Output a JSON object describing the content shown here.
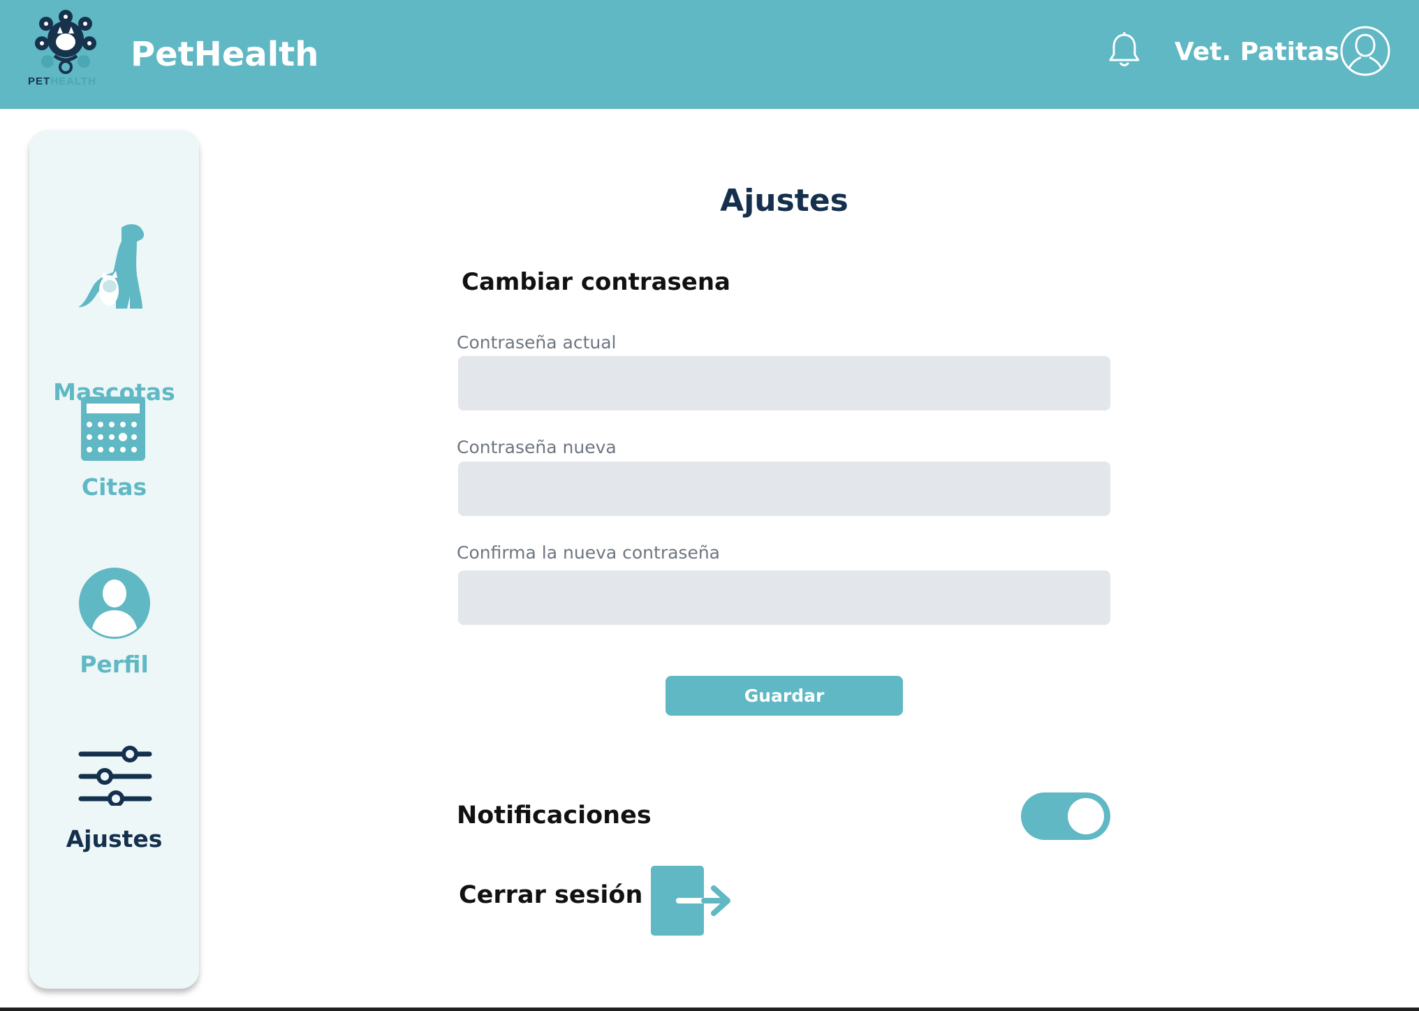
{
  "header": {
    "logo_word_pet": "PET",
    "logo_word_health": "HEALTH",
    "brand": "PetHealth",
    "user_name": "Vet. Patitas"
  },
  "sidebar": {
    "items": [
      {
        "label": "Mascotas",
        "icon": "pets-icon",
        "active": false
      },
      {
        "label": "Citas",
        "icon": "calendar-icon",
        "active": false
      },
      {
        "label": "Perfil",
        "icon": "profile-icon",
        "active": false
      },
      {
        "label": "Ajustes",
        "icon": "sliders-icon",
        "active": true
      }
    ]
  },
  "main": {
    "title": "Ajustes",
    "password_section": {
      "title": "Cambiar contrasena",
      "fields": [
        {
          "label": "Contraseña actual",
          "value": "",
          "placeholder": ""
        },
        {
          "label": "Contraseña nueva",
          "value": "",
          "placeholder": ""
        },
        {
          "label": "Confirma la nueva contraseña",
          "value": "",
          "placeholder": ""
        }
      ],
      "save_label": "Guardar"
    },
    "notifications": {
      "label": "Notificaciones",
      "enabled": true
    },
    "logout": {
      "label": "Cerrar sesión"
    }
  },
  "colors": {
    "accent": "#5fb8c4",
    "dark": "#14304d",
    "input_bg": "#e3e6ea",
    "sidebar_bg": "#eef7f8"
  }
}
